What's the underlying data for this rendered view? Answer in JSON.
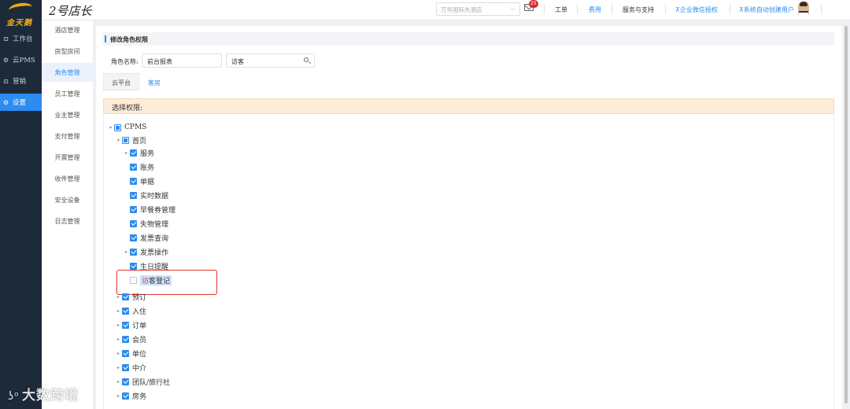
{
  "rail": {
    "logo_text": "金天鹅",
    "items": [
      {
        "label": "工作台",
        "icon": "square-icon"
      },
      {
        "label": "云PMS",
        "icon": "gear-icon"
      },
      {
        "label": "营销",
        "icon": "square-icon"
      },
      {
        "label": "设置",
        "icon": "gear-icon",
        "active": true
      }
    ]
  },
  "topbar": {
    "brand": "2号店长",
    "hotel_select": "万华国际大酒店",
    "mail_badge": "25",
    "links": [
      "工单",
      "费用",
      "服务与支持",
      "⊼企业微信授权",
      "⊼系统自动创建用户"
    ]
  },
  "subnav": {
    "items": [
      "酒店管理",
      "房型房间",
      "角色管理",
      "员工管理",
      "业主管理",
      "支付管理",
      "开票管理",
      "收件管理",
      "安全设备",
      "日志管理"
    ],
    "active_index": 2
  },
  "main": {
    "section_title": "修改角色权限",
    "role_label": "角色名称:",
    "role_value": "前台报表",
    "search_value": "访客",
    "tabs": [
      "云平台",
      "客房"
    ],
    "active_tab": 1,
    "perm_title": "选择权限:",
    "tree": {
      "root": "CPMS",
      "home": "首页",
      "home_children": [
        "服务",
        "账务",
        "单据",
        "实时数据",
        "早餐券管理",
        "失物管理",
        "发票查询",
        "发票操作",
        "生日提醒"
      ],
      "visitor": {
        "pre": "访",
        "rest": "客登记"
      },
      "top_level": [
        "预订",
        "入住",
        "订单",
        "会员",
        "单位",
        "中介",
        "团队/旅行社",
        "房务"
      ]
    }
  },
  "watermark": "大数跨境",
  "colors": {
    "accent": "#2d8cf0",
    "rail": "#1d2a3a",
    "callout": "#e1362b",
    "perm_bar": "#fcecd8"
  }
}
